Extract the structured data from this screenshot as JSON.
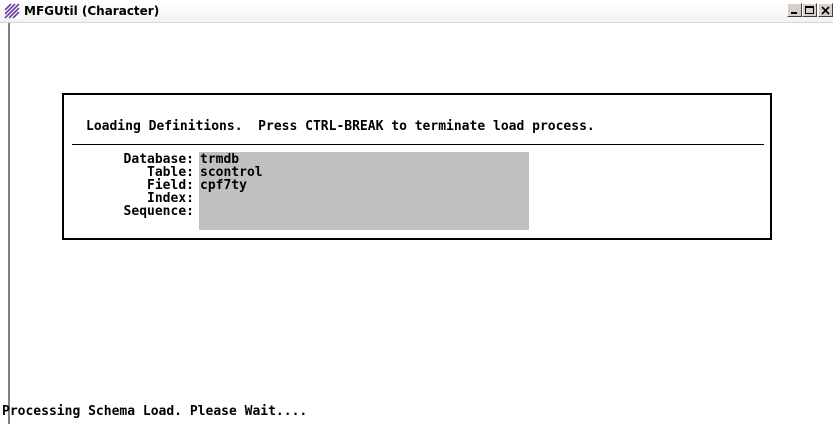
{
  "window": {
    "title": "MFGUtil (Character)",
    "controls": {
      "minimize_icon": "minimize-icon",
      "maximize_icon": "maximize-icon",
      "close_icon": "close-icon"
    }
  },
  "dialog": {
    "header": "Loading Definitions.  Press CTRL-BREAK to terminate load process.",
    "fields": [
      {
        "label": "Database:",
        "value": "trmdb"
      },
      {
        "label": "Table:",
        "value": "scontrol"
      },
      {
        "label": "Field:",
        "value": "cpf7ty"
      },
      {
        "label": "Index:",
        "value": ""
      },
      {
        "label": "Sequence:",
        "value": ""
      }
    ],
    "value_box_color": "#c0c0c0"
  },
  "status": {
    "message": "Processing Schema Load. Please Wait...."
  }
}
